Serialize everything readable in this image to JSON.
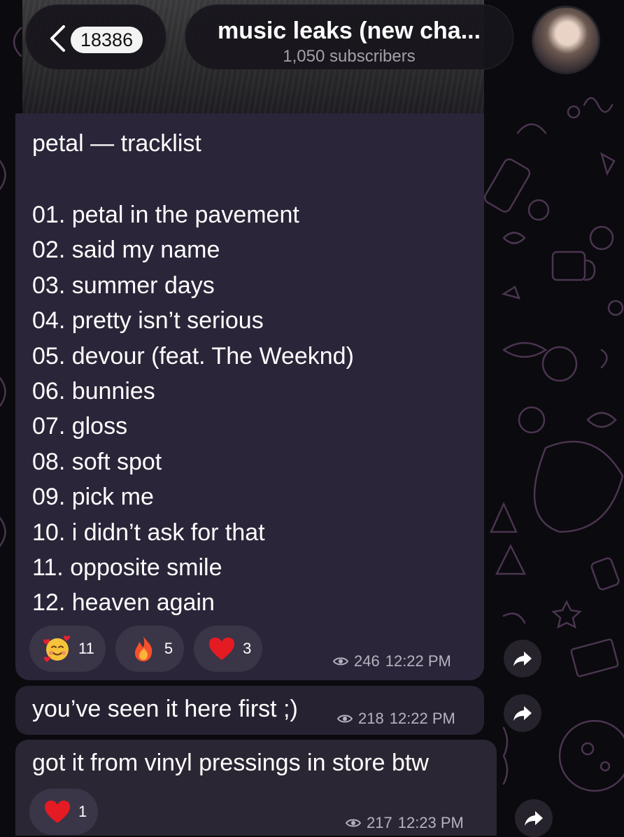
{
  "header": {
    "back_count": "18386",
    "channel_title": "music leaks (new cha...",
    "subscribers": "1,050 subscribers"
  },
  "messages": [
    {
      "title": "petal — tracklist",
      "tracks": [
        "01. petal in the pavement",
        "02. said my name",
        "03. summer days",
        "04. pretty isn’t serious",
        "05. devour (feat. The Weeknd)",
        "06. bunnies",
        "07. gloss",
        "08. soft spot",
        "09. pick me",
        "10. i didn’t ask for that",
        "11. opposite smile",
        "12. heaven again"
      ],
      "reactions": [
        {
          "emoji": "smiling-face-with-hearts",
          "count": "11"
        },
        {
          "emoji": "fire",
          "count": "5"
        },
        {
          "emoji": "red-heart",
          "count": "3"
        }
      ],
      "views": "246",
      "time": "12:22 PM"
    },
    {
      "text": "you’ve seen it here first ;)",
      "views": "218",
      "time": "12:22 PM"
    },
    {
      "text": "got it from vinyl pressings in store btw",
      "reactions": [
        {
          "emoji": "red-heart",
          "count": "1"
        }
      ],
      "views": "217",
      "time": "12:23 PM"
    }
  ],
  "colors": {
    "background": "#0b0a0e",
    "bubble": "#2a2538",
    "reaction_pill": "#3b3548",
    "doodle": "#4a3550"
  }
}
